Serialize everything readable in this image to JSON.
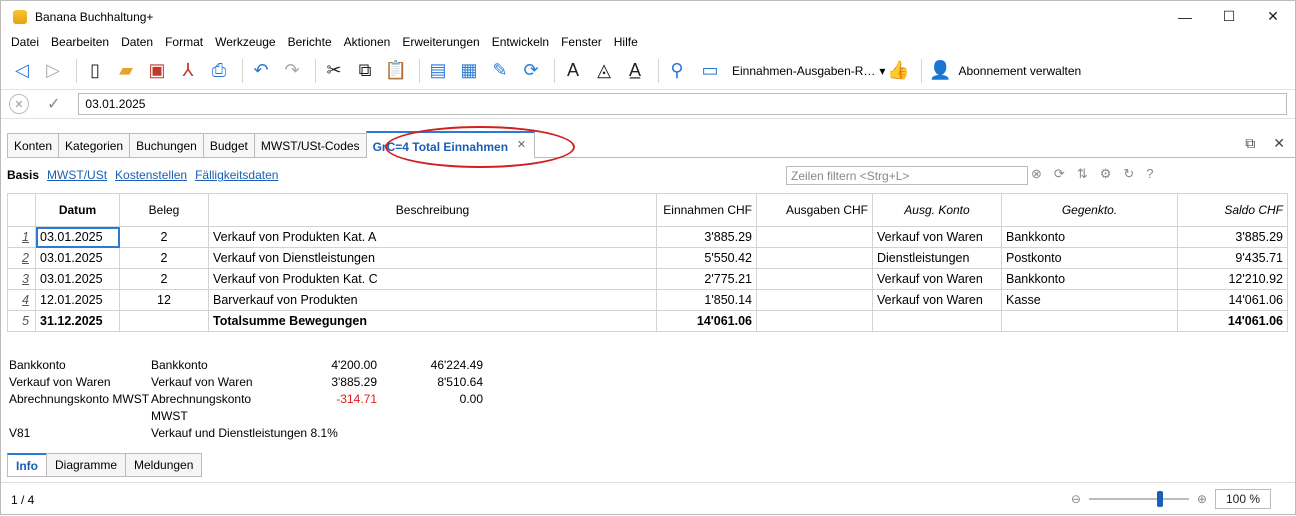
{
  "window": {
    "title": "Banana Buchhaltung+",
    "controls": [
      "—",
      "☐",
      "✕"
    ]
  },
  "menu": [
    "Datei",
    "Bearbeiten",
    "Daten",
    "Format",
    "Werkzeuge",
    "Berichte",
    "Aktionen",
    "Erweiterungen",
    "Entwickeln",
    "Fenster",
    "Hilfe"
  ],
  "toolbar": {
    "layout_select": "Einnahmen-Ausgaben-R…",
    "subscription": "Abonnement verwalten"
  },
  "entry": {
    "value": "03.01.2025"
  },
  "tabs": [
    "Konten",
    "Kategorien",
    "Buchungen",
    "Budget",
    "MWST/USt-Codes"
  ],
  "active_tab": "GrC=4 Total Einnahmen",
  "views": {
    "basis": "Basis",
    "links": [
      "MWST/USt",
      "Kostenstellen",
      "Fälligkeitsdaten"
    ]
  },
  "filter": {
    "placeholder": "Zeilen filtern <Strg+L>"
  },
  "table": {
    "headers": [
      "Datum",
      "Beleg",
      "Beschreibung",
      "Einnahmen CHF",
      "Ausgaben CHF",
      "Ausg. Konto",
      "Gegenkto.",
      "Saldo CHF"
    ],
    "rows": [
      {
        "n": "1",
        "datum": "03.01.2025",
        "beleg": "2",
        "beschr": "Verkauf von Produkten Kat. A",
        "ein": "3'885.29",
        "aus": "",
        "konto": "Verkauf von Waren",
        "gegen": "Bankkonto",
        "saldo": "3'885.29"
      },
      {
        "n": "2",
        "datum": "03.01.2025",
        "beleg": "2",
        "beschr": "Verkauf von Dienstleistungen",
        "ein": "5'550.42",
        "aus": "",
        "konto": "Dienstleistungen",
        "gegen": "Postkonto",
        "saldo": "9'435.71"
      },
      {
        "n": "3",
        "datum": "03.01.2025",
        "beleg": "2",
        "beschr": "Verkauf von Produkten Kat. C",
        "ein": "2'775.21",
        "aus": "",
        "konto": "Verkauf von Waren",
        "gegen": "Bankkonto",
        "saldo": "12'210.92"
      },
      {
        "n": "4",
        "datum": "12.01.2025",
        "beleg": "12",
        "beschr": "Barverkauf von Produkten",
        "ein": "1'850.14",
        "aus": "",
        "konto": "Verkauf von Waren",
        "gegen": "Kasse",
        "saldo": "14'061.06"
      }
    ],
    "total": {
      "n": "5",
      "datum": "31.12.2025",
      "beleg": "",
      "beschr": "Totalsumme Bewegungen",
      "ein": "14'061.06",
      "aus": "",
      "konto": "",
      "gegen": "",
      "saldo": "14'061.06"
    }
  },
  "info": [
    {
      "a": "Bankkonto",
      "b": "Bankkonto",
      "c": "4'200.00",
      "d": "46'224.49"
    },
    {
      "a": "Verkauf von Waren",
      "b": "Verkauf von Waren",
      "c": "3'885.29",
      "d": "8'510.64"
    },
    {
      "a": "Abrechnungskonto MWST",
      "b": "Abrechnungskonto MWST",
      "c": "-314.71",
      "d": "0.00"
    },
    {
      "a": "V81",
      "b": "Verkauf und Dienstleistungen 8.1%",
      "c": "",
      "d": ""
    }
  ],
  "bottom_tabs": [
    "Info",
    "Diagramme",
    "Meldungen"
  ],
  "status": {
    "rows": "1 / 4",
    "zoom": "100 %"
  }
}
